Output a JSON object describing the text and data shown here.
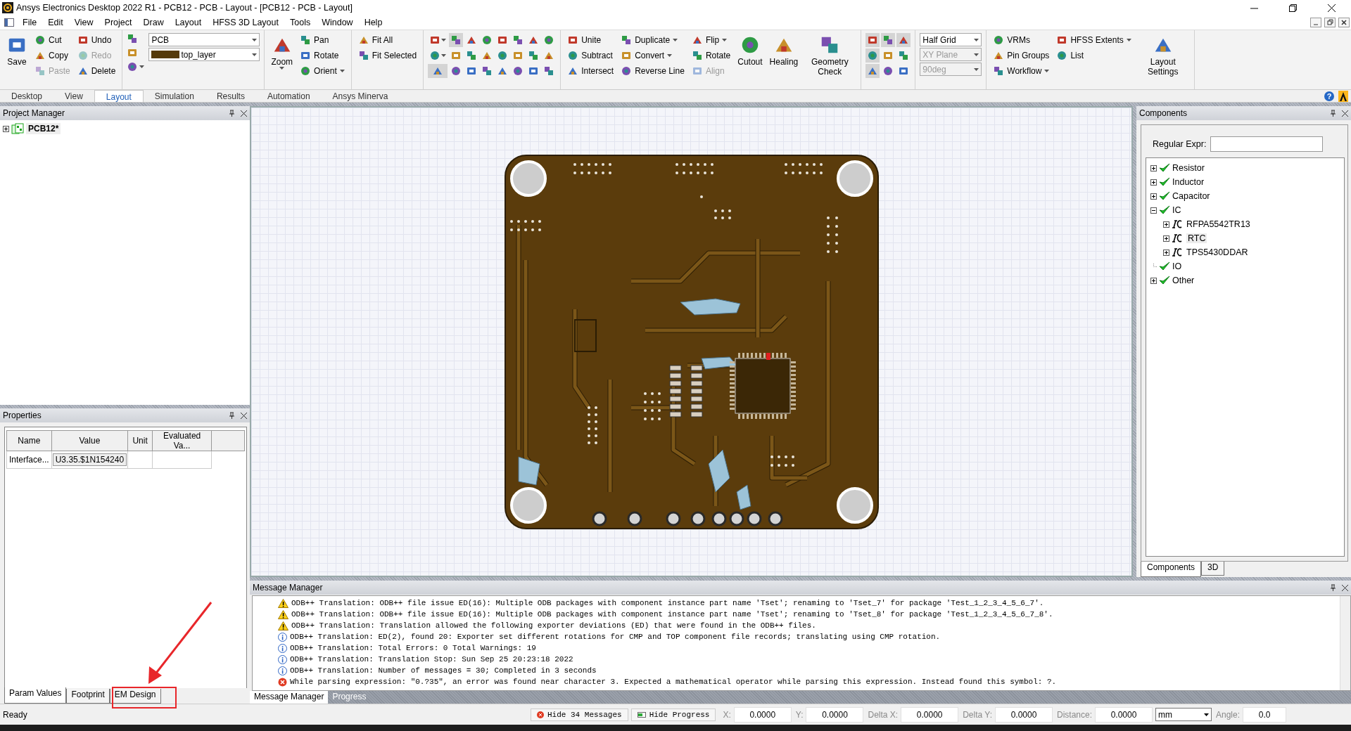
{
  "window": {
    "title": "Ansys Electronics Desktop 2022 R1 - PCB12 - PCB - Layout - [PCB12 - PCB - Layout]"
  },
  "menu": [
    "File",
    "Edit",
    "View",
    "Project",
    "Draw",
    "Layout",
    "HFSS 3D Layout",
    "Tools",
    "Window",
    "Help"
  ],
  "ribbon": {
    "groups": [
      {
        "items": [
          {
            "kind": "large",
            "label": "Save",
            "menu": false
          },
          {
            "kind": "column",
            "items": [
              {
                "label": "Cut",
                "disabled": false,
                "menu": false
              },
              {
                "label": "Copy",
                "disabled": false,
                "menu": false
              },
              {
                "label": "Paste",
                "disabled": true,
                "menu": false
              }
            ]
          },
          {
            "kind": "column",
            "items": [
              {
                "label": "Undo",
                "disabled": false,
                "menu": false
              },
              {
                "label": "Redo",
                "disabled": true,
                "menu": false
              },
              {
                "label": "Delete",
                "disabled": false,
                "menu": false
              }
            ]
          }
        ]
      },
      {
        "items": [
          {
            "kind": "layers",
            "selects": [
              {
                "value": "PCB",
                "swatch": false
              },
              {
                "value": "top_layer",
                "swatch": true
              }
            ]
          }
        ]
      },
      {
        "items": [
          {
            "kind": "large",
            "label": "Zoom",
            "menu": true
          },
          {
            "kind": "column",
            "items": [
              {
                "label": "Pan",
                "disabled": false,
                "menu": false
              },
              {
                "label": "Rotate",
                "disabled": false,
                "menu": false
              },
              {
                "label": "Orient",
                "disabled": false,
                "menu": true
              }
            ]
          }
        ]
      },
      {
        "items": [
          {
            "kind": "column",
            "items": [
              {
                "label": "Fit All",
                "disabled": false,
                "menu": false
              },
              {
                "label": "Fit Selected",
                "disabled": false,
                "menu": false
              }
            ]
          }
        ]
      },
      {
        "items": [
          {
            "kind": "icon-grid",
            "buttons": [
              {
                "selected": false,
                "menu": true
              },
              {
                "selected": false,
                "menu": true
              },
              {
                "selected": true,
                "menu": false
              },
              {
                "selected": true,
                "menu": false
              },
              {
                "selected": false,
                "menu": false
              },
              {
                "selected": false,
                "menu": false
              },
              {
                "selected": false,
                "menu": false
              },
              {
                "selected": false,
                "menu": false
              },
              {
                "selected": false,
                "menu": false
              },
              {
                "selected": false,
                "menu": false
              },
              {
                "selected": false,
                "menu": false
              },
              {
                "selected": false,
                "menu": false
              },
              {
                "selected": false,
                "menu": false
              },
              {
                "selected": false,
                "menu": false
              },
              {
                "selected": false,
                "menu": false
              },
              {
                "selected": false,
                "menu": false
              },
              {
                "selected": false,
                "menu": false
              },
              {
                "selected": false,
                "menu": false
              },
              {
                "selected": false,
                "menu": false
              },
              {
                "selected": false,
                "menu": false
              },
              {
                "selected": false,
                "menu": false
              },
              {
                "selected": false,
                "menu": false
              },
              {
                "selected": false,
                "menu": false
              },
              {
                "selected": false,
                "menu": false
              }
            ]
          }
        ]
      },
      {
        "items": [
          {
            "kind": "column",
            "items": [
              {
                "label": "Unite",
                "disabled": false,
                "menu": false
              },
              {
                "label": "Subtract",
                "disabled": false,
                "menu": false
              },
              {
                "label": "Intersect",
                "disabled": false,
                "menu": false
              }
            ]
          },
          {
            "kind": "column",
            "items": [
              {
                "label": "Duplicate",
                "disabled": false,
                "menu": true
              },
              {
                "label": "Convert",
                "disabled": false,
                "menu": true
              },
              {
                "label": "Reverse Line",
                "disabled": false,
                "menu": false
              }
            ]
          },
          {
            "kind": "column",
            "items": [
              {
                "label": "Flip",
                "disabled": false,
                "menu": true
              },
              {
                "label": "Rotate",
                "disabled": false,
                "menu": false
              },
              {
                "label": "Align",
                "disabled": true,
                "menu": false
              }
            ]
          },
          {
            "kind": "large",
            "label": "Cutout",
            "menu": false
          },
          {
            "kind": "large",
            "label": "Healing",
            "menu": false
          },
          {
            "kind": "large",
            "label": "Geometry Check",
            "menu": false
          }
        ]
      },
      {
        "items": [
          {
            "kind": "icon-grid",
            "buttons": [
              {
                "selected": true,
                "menu": false
              },
              {
                "selected": true,
                "menu": false
              },
              {
                "selected": true,
                "menu": false
              },
              {
                "selected": true,
                "menu": false
              },
              {
                "selected": false,
                "menu": false
              },
              {
                "selected": false,
                "menu": false
              },
              {
                "selected": true,
                "menu": false
              },
              {
                "selected": false,
                "menu": false
              },
              {
                "selected": false,
                "menu": false
              }
            ]
          }
        ]
      },
      {
        "items": [
          {
            "kind": "selects",
            "selects": [
              {
                "value": "Half Grid",
                "disabled": false
              },
              {
                "value": "XY Plane",
                "disabled": true
              },
              {
                "value": "90deg",
                "disabled": true
              }
            ]
          }
        ]
      },
      {
        "items": [
          {
            "kind": "column",
            "items": [
              {
                "label": "VRMs",
                "disabled": false,
                "menu": false
              },
              {
                "label": "Pin Groups",
                "disabled": false,
                "menu": false
              },
              {
                "label": "Workflow",
                "disabled": false,
                "menu": true
              }
            ]
          },
          {
            "kind": "column",
            "items": [
              {
                "label": "HFSS Extents",
                "disabled": false,
                "menu": true
              },
              {
                "label": "List",
                "disabled": false,
                "menu": false
              }
            ]
          },
          {
            "kind": "large",
            "label": "Layout Settings",
            "menu": false
          }
        ]
      }
    ]
  },
  "tabs": [
    {
      "label": "Desktop",
      "selected": false
    },
    {
      "label": "View",
      "selected": false
    },
    {
      "label": "Layout",
      "selected": true
    },
    {
      "label": "Simulation",
      "selected": false
    },
    {
      "label": "Results",
      "selected": false
    },
    {
      "label": "Automation",
      "selected": false
    },
    {
      "label": "Ansys Minerva",
      "selected": false
    }
  ],
  "help_label": "?",
  "project_manager": {
    "title": "Project Manager",
    "items": [
      {
        "label": "PCB12*",
        "expanded": false
      }
    ]
  },
  "properties": {
    "title": "Properties",
    "columns": [
      "Name",
      "Value",
      "Unit",
      "Evaluated Va..."
    ],
    "rows": [
      {
        "name": "Interface...",
        "value": "U3.35.$1N154240"
      }
    ],
    "tabs": [
      {
        "label": "Param Values",
        "selected": true
      },
      {
        "label": "Footprint",
        "selected": false
      },
      {
        "label": "EM Design",
        "selected": false
      }
    ]
  },
  "components": {
    "title": "Components",
    "filter_label": "Regular Expr:",
    "tree": [
      {
        "label": "Resistor",
        "kind": "category",
        "expandable": true,
        "expanded": false,
        "selected": false
      },
      {
        "label": "Inductor",
        "kind": "category",
        "expandable": true,
        "expanded": false,
        "selected": false
      },
      {
        "label": "Capacitor",
        "kind": "category",
        "expandable": true,
        "expanded": false,
        "selected": false
      },
      {
        "label": "IC",
        "kind": "category",
        "expandable": true,
        "expanded": true,
        "selected": false,
        "children": [
          {
            "label": "RFPA5542TR13",
            "kind": "ic",
            "expandable": true,
            "expanded": false,
            "selected": false
          },
          {
            "label": "RTC",
            "kind": "ic",
            "expandable": true,
            "expanded": false,
            "selected": true
          },
          {
            "label": "TPS5430DDAR",
            "kind": "ic",
            "expandable": true,
            "expanded": false,
            "selected": false
          }
        ]
      },
      {
        "label": "IO",
        "kind": "category",
        "expandable": false,
        "expanded": false,
        "selected": false
      },
      {
        "label": "Other",
        "kind": "category",
        "expandable": true,
        "expanded": false,
        "selected": false
      }
    ],
    "tabs": [
      {
        "label": "Components",
        "selected": true
      },
      {
        "label": "3D",
        "selected": false
      }
    ]
  },
  "message_manager": {
    "title": "Message Manager",
    "messages": [
      {
        "kind": "warning",
        "text": "ODB++ Translation: ODB++ file issue ED(16): Multiple ODB packages with component instance part name 'Tset'; renaming to 'Tset_7' for package 'Test_1_2_3_4_5_6_7'."
      },
      {
        "kind": "warning",
        "text": "ODB++ Translation: ODB++ file issue ED(16): Multiple ODB packages with component instance part name 'Tset'; renaming to 'Tset_8' for package 'Test_1_2_3_4_5_6_7_8'."
      },
      {
        "kind": "warning",
        "text": "ODB++ Translation: Translation allowed the following exporter deviations (ED) that were found in the ODB++ files."
      },
      {
        "kind": "info",
        "text": "ODB++ Translation: ED(2), found 20: Exporter set different rotations for CMP and TOP component file records; translating using CMP rotation."
      },
      {
        "kind": "info",
        "text": "ODB++ Translation: Total Errors: 0 Total Warnings: 19"
      },
      {
        "kind": "info",
        "text": "ODB++ Translation: Translation Stop: Sun Sep 25 20:23:18 2022"
      },
      {
        "kind": "info",
        "text": "ODB++ Translation: Number of messages = 30; Completed in 3 seconds"
      },
      {
        "kind": "error",
        "text": "While parsing expression: \"0.?35\", an error was found near character 3. Expected a mathematical operator while parsing this expression. Instead found this symbol: ?."
      }
    ],
    "tabs": [
      {
        "label": "Message Manager",
        "selected": true
      },
      {
        "label": "Progress",
        "selected": false
      }
    ]
  },
  "status_bar": {
    "text": "Ready",
    "buttons": [
      {
        "kind": "messages",
        "label": "Hide 34 Messages"
      },
      {
        "kind": "progress",
        "label": "Hide Progress"
      }
    ],
    "fields": [
      {
        "label": "X:",
        "value": "0.0000"
      },
      {
        "label": "Y:",
        "value": "0.0000"
      },
      {
        "label": "Delta X:",
        "value": "0.0000"
      },
      {
        "label": "Delta Y:",
        "value": "0.0000"
      },
      {
        "label": "Distance:",
        "value": "0.0000"
      }
    ],
    "unit": "mm",
    "angle": {
      "label": "Angle:",
      "value": "0.0"
    }
  }
}
